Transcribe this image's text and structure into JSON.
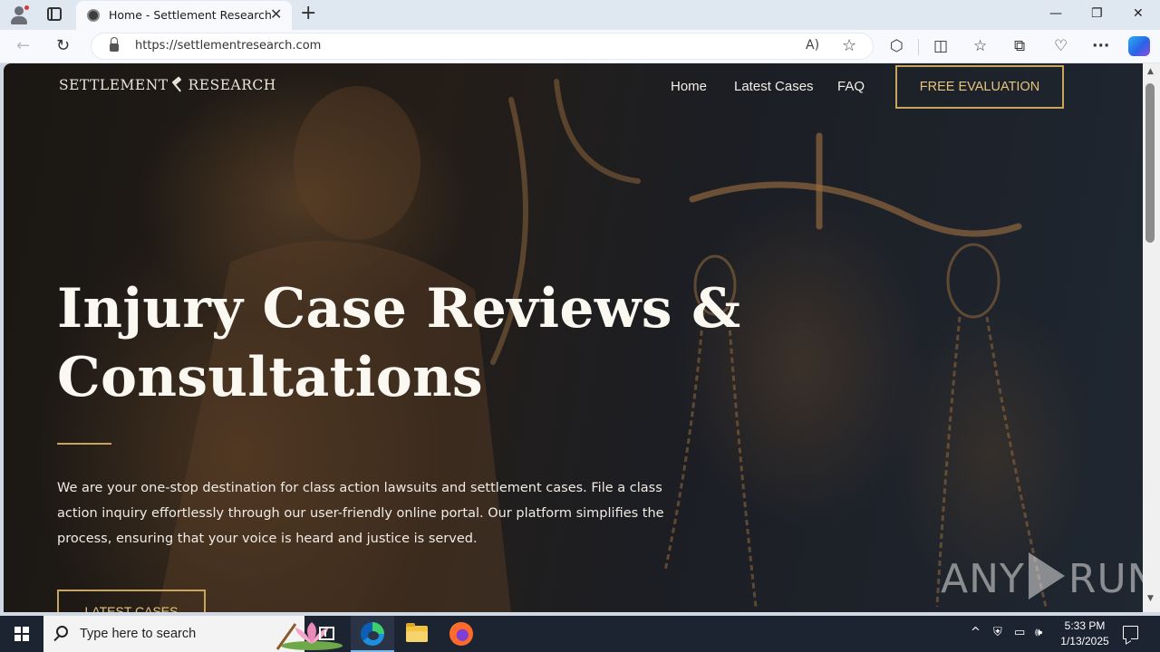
{
  "browser": {
    "tab_title": "Home - Settlement Research",
    "tab_close": "✕",
    "new_tab": "+",
    "url": "https://settlementresearch.com",
    "read_aloud": "A)",
    "favorite": "☆",
    "minimize": "—",
    "restore": "❐",
    "close": "✕",
    "back": "←",
    "refresh": "↻",
    "menu_dots": "···"
  },
  "site": {
    "logo_left": "SETTLEMENT",
    "logo_right": "RESEARCH",
    "nav": {
      "home": "Home",
      "latest_cases": "Latest Cases",
      "faq": "FAQ",
      "cta": "FREE EVALUATION"
    },
    "hero": {
      "title_line1": "Injury Case Reviews &",
      "title_line2": "Consultations",
      "description": "We are your one-stop destination for class action lawsuits and settlement cases. File a class action inquiry effortlessly through our user-friendly online portal. Our platform simplifies the process, ensuring that your voice is heard and justice is served.",
      "button": "LATEST CASES"
    },
    "accent_color": "#c9a45c"
  },
  "watermark": {
    "left": "ANY",
    "right": "RUN"
  },
  "taskbar": {
    "search_placeholder": "Type here to search",
    "time": "5:33 PM",
    "date": "1/13/2025"
  }
}
